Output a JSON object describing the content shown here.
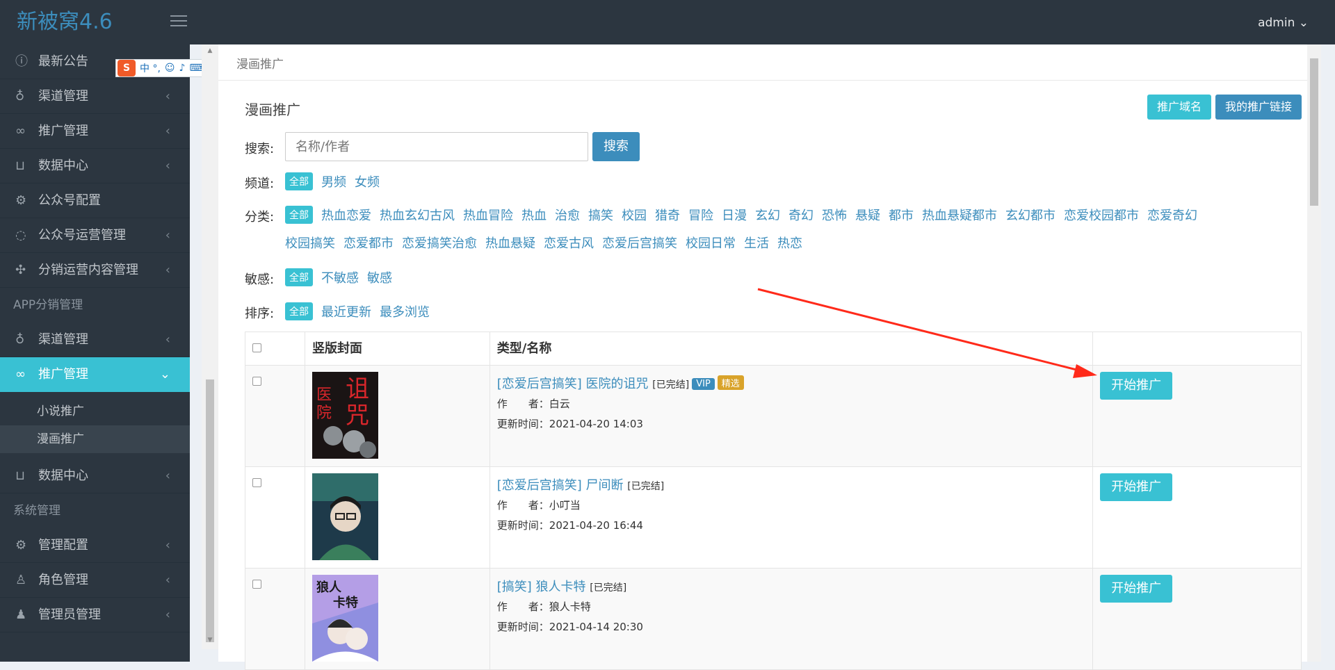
{
  "app": {
    "title": "新被窝4.6",
    "user": "admin ⌄"
  },
  "sidebar": {
    "items_top": [
      {
        "label": "最新公告",
        "icon": "info-icon",
        "arrow": ""
      },
      {
        "label": "渠道管理",
        "icon": "bulb-icon",
        "arrow": "‹"
      },
      {
        "label": "推广管理",
        "icon": "link-icon",
        "arrow": "‹"
      },
      {
        "label": "数据中心",
        "icon": "cart-icon",
        "arrow": "‹"
      },
      {
        "label": "公众号配置",
        "icon": "gear-icon",
        "arrow": ""
      },
      {
        "label": "公众号运营管理",
        "icon": "chat-icon",
        "arrow": "‹"
      },
      {
        "label": "分销运营内容管理",
        "icon": "puzzle-icon",
        "arrow": "‹"
      }
    ],
    "header_app": "APP分销管理",
    "items_app": [
      {
        "label": "渠道管理",
        "icon": "bulb-icon",
        "arrow": "‹"
      },
      {
        "label": "推广管理",
        "icon": "link-icon",
        "arrow": "⌄"
      }
    ],
    "sub_items": [
      {
        "label": "小说推广"
      },
      {
        "label": "漫画推广"
      }
    ],
    "item_data": {
      "label": "数据中心",
      "icon": "cart-icon",
      "arrow": "‹"
    },
    "header_sys": "系统管理",
    "items_sys": [
      {
        "label": "管理配置",
        "icon": "gear-icon",
        "arrow": "‹"
      },
      {
        "label": "角色管理",
        "icon": "user-icon",
        "arrow": "‹"
      },
      {
        "label": "管理员管理",
        "icon": "admin-icon",
        "arrow": "‹"
      }
    ]
  },
  "ime": {
    "chars": "中 °,"
  },
  "breadcrumb": "漫画推广",
  "box": {
    "title": "漫画推广",
    "btn_domain": "推广域名",
    "btn_mylink": "我的推广链接"
  },
  "search": {
    "label": "搜索:",
    "placeholder": "名称/作者",
    "button": "搜索"
  },
  "filters": {
    "channel": {
      "label": "频道:",
      "options": [
        "全部",
        "男频",
        "女频"
      ]
    },
    "category": {
      "label": "分类:",
      "options": [
        "全部",
        "热血恋爱",
        "热血玄幻古风",
        "热血冒险",
        "热血",
        "治愈",
        "搞笑",
        "校园",
        "猎奇",
        "冒险",
        "日漫",
        "玄幻",
        "奇幻",
        "恐怖",
        "悬疑",
        "都市",
        "热血悬疑都市",
        "玄幻都市",
        "恋爱校园都市",
        "恋爱奇幻",
        "校园搞笑",
        "恋爱都市",
        "恋爱搞笑治愈",
        "热血悬疑",
        "恋爱古风",
        "恋爱后宫搞笑",
        "校园日常",
        "生活",
        "热恋"
      ]
    },
    "sensitive": {
      "label": "敏感:",
      "options": [
        "全部",
        "不敏感",
        "敏感"
      ]
    },
    "sort": {
      "label": "排序:",
      "options": [
        "全部",
        "最近更新",
        "最多浏览"
      ]
    }
  },
  "table": {
    "headers": [
      "",
      "竖版封面",
      "类型/名称",
      ""
    ],
    "rows": [
      {
        "title": "[恋爱后宫搞笑] 医院的诅咒",
        "status": "[已完结]",
        "vip": "VIP",
        "featured": "精选",
        "author": "作　　者：白云",
        "updated": "更新时间：2021-04-20 14:03",
        "action": "开始推广"
      },
      {
        "title": "[恋爱后宫搞笑] 尸间断",
        "status": "[已完结]",
        "vip": "",
        "featured": "",
        "author": "作　　者：小叮当",
        "updated": "更新时间：2021-04-20 16:44",
        "action": "开始推广"
      },
      {
        "title": "[搞笑] 狼人卡特",
        "status": "[已完结]",
        "vip": "",
        "featured": "",
        "author": "作　　者：狼人卡特",
        "updated": "更新时间：2021-04-14 20:30",
        "action": "开始推广"
      }
    ]
  },
  "colors": {
    "accent": "#39c1d3",
    "primary": "#3c8dbc",
    "sidebar": "#2c3640",
    "annotation": "#ff2a1a"
  }
}
